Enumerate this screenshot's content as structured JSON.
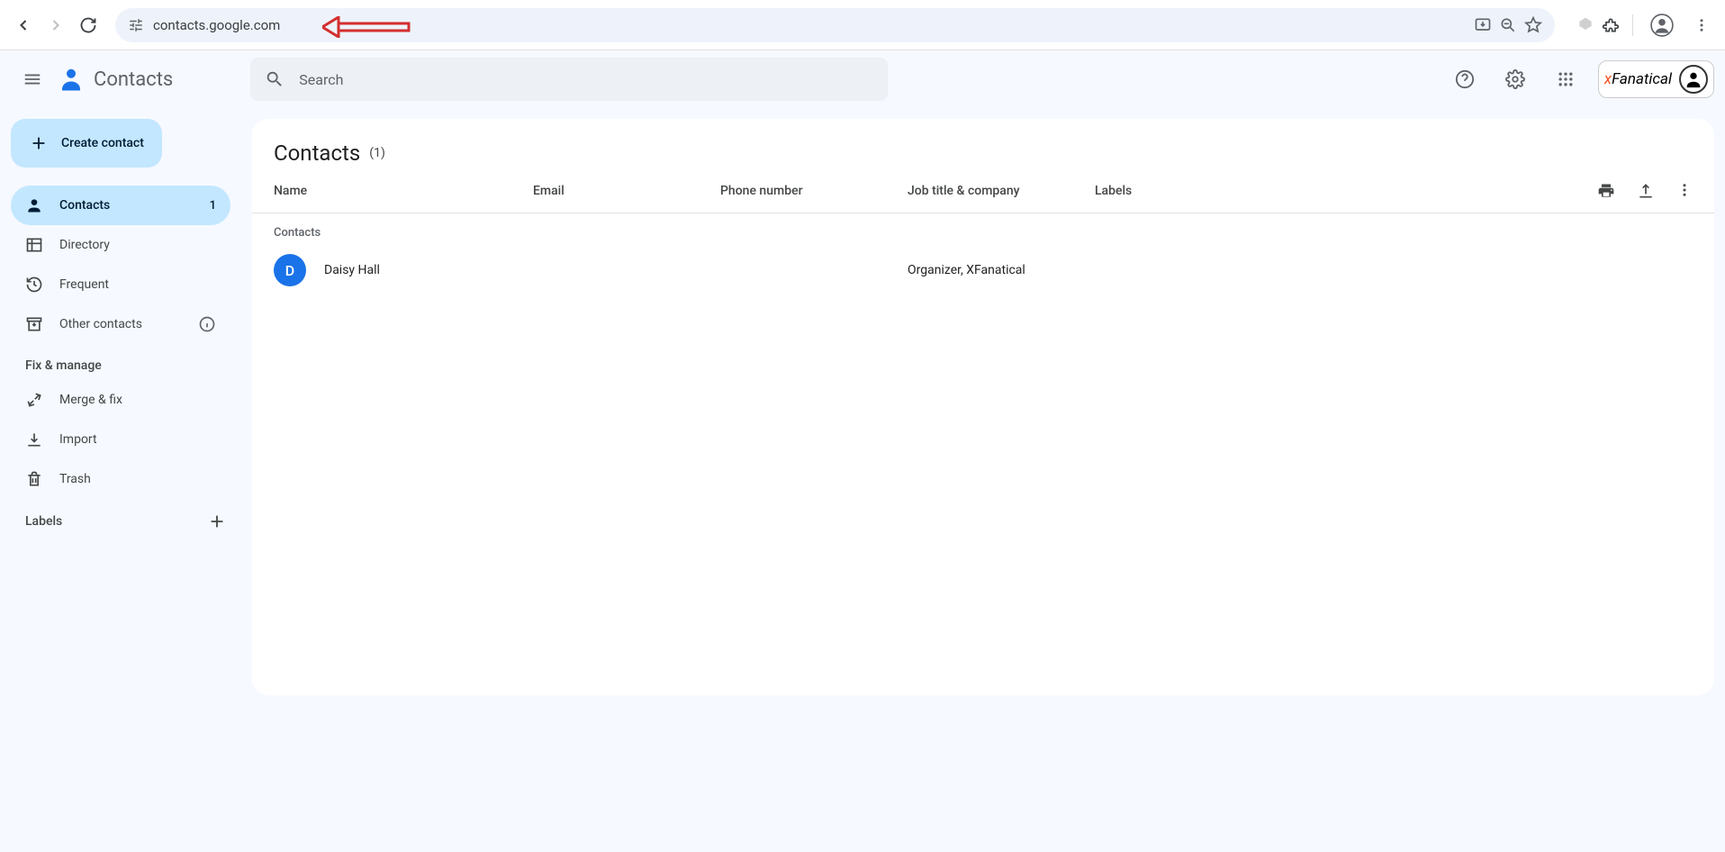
{
  "browser": {
    "url": "contacts.google.com"
  },
  "app": {
    "name": "Contacts",
    "search_placeholder": "Search"
  },
  "account": {
    "brand_prefix": "x",
    "brand_name": "Fanatical"
  },
  "sidebar": {
    "create_label": "Create contact",
    "items": [
      {
        "label": "Contacts",
        "count": "1"
      },
      {
        "label": "Directory"
      },
      {
        "label": "Frequent"
      },
      {
        "label": "Other contacts"
      }
    ],
    "section_fix": "Fix & manage",
    "fix_items": [
      {
        "label": "Merge & fix"
      },
      {
        "label": "Import"
      },
      {
        "label": "Trash"
      }
    ],
    "labels_header": "Labels"
  },
  "content": {
    "title": "Contacts",
    "count_paren": "(1)",
    "columns": {
      "name": "Name",
      "email": "Email",
      "phone": "Phone number",
      "job": "Job title & company",
      "labels": "Labels"
    },
    "section_label": "Contacts",
    "rows": [
      {
        "initial": "D",
        "name": "Daisy Hall",
        "email": "",
        "phone": "",
        "job": "Organizer, XFanatical",
        "labels": ""
      }
    ]
  }
}
